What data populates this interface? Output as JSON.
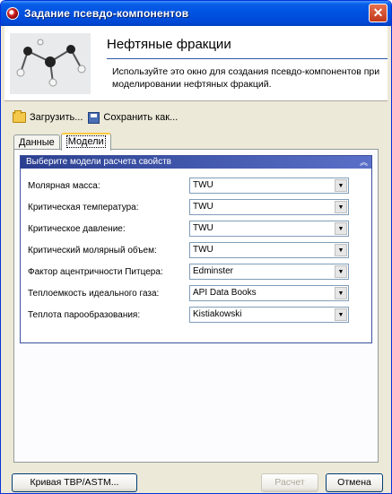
{
  "window": {
    "title": "Задание псевдо-компонентов",
    "close_glyph": "✕"
  },
  "header": {
    "title": "Нефтяные фракции",
    "description": "Используйте это окно для создания псевдо-компонентов при моделировании нефтяных фракций."
  },
  "toolbar": {
    "load_label": "Загрузить...",
    "save_as_label": "Сохранить как...",
    "icons": [
      "folder-open-icon",
      "floppy-disk-icon"
    ]
  },
  "tabs": [
    {
      "label": "Данные",
      "active": false
    },
    {
      "label": "Модели",
      "active": true
    }
  ],
  "models_group": {
    "title": "Выберите модели расчета свойств",
    "collapse_glyph": "︽",
    "properties": [
      {
        "label": "Молярная масса:",
        "value": "TWU"
      },
      {
        "label": "Критическая температура:",
        "value": "TWU"
      },
      {
        "label": "Критическое давление:",
        "value": "TWU"
      },
      {
        "label": "Критический молярный объем:",
        "value": "TWU"
      },
      {
        "label": "Фактор ацентричности Питцера:",
        "value": "Edminster"
      },
      {
        "label": "Теплоемкость идеального газа:",
        "value": "API Data Books"
      },
      {
        "label": "Теплота парообразования:",
        "value": "Kistiakowski"
      }
    ],
    "dropdown_glyph": "▼"
  },
  "buttons": {
    "tbp_curve": "Кривая TBP/ASTM...",
    "calculate": "Расчет",
    "cancel": "Отмена"
  },
  "colors": {
    "titlebar": "#0054e3",
    "group_header": "#2a3f8f",
    "close_button": "#c0381a"
  }
}
